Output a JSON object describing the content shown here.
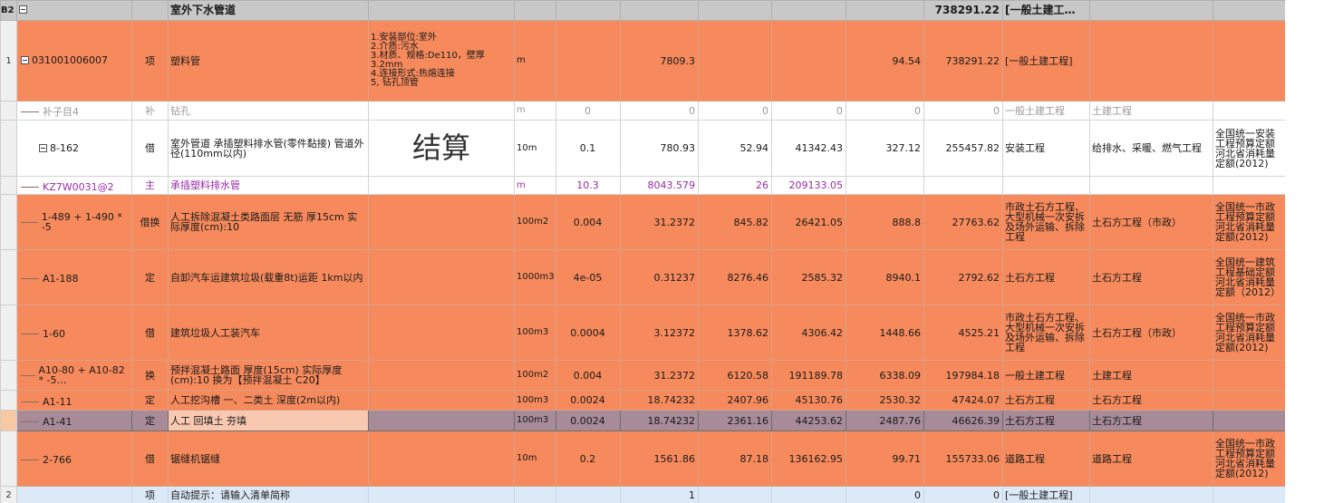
{
  "header": {
    "row_label": "B2",
    "title": "室外下水管道",
    "total": "738291.22",
    "category": "[一般土建工…"
  },
  "rows": [
    {
      "id": "r1",
      "style": "org",
      "no": "1",
      "toggle": true,
      "code": "031001006007",
      "type": "项",
      "name": "塑料管",
      "feature": "1.安装部位:室外\n2.介质:污水\n3.材质、规格:De110，壁厚3.2mm\n4.连接形式:热熔连接\n5, 钻孔顶管",
      "unit": "m",
      "qty": "",
      "amount": "7809.3",
      "price": "",
      "total_m": "",
      "unit_price": "94.54",
      "total": "738291.22",
      "spec": "[一般土建工程]",
      "sub": "",
      "quota": ""
    },
    {
      "id": "r2",
      "style": "white",
      "no": "",
      "toggle": false,
      "code": "补子目4",
      "type": "补",
      "name": "钻孔",
      "feature": "",
      "unit": "m",
      "qty": "0",
      "amount": "0",
      "price": "0",
      "total_m": "0",
      "unit_price": "0",
      "total": "0",
      "spec": "一般土建工程",
      "sub": "土建工程",
      "quota": "",
      "muted": true
    },
    {
      "id": "r3",
      "style": "white",
      "no": "",
      "toggle": true,
      "code": "8-162",
      "type": "借",
      "name": "室外管道 承插塑料排水管(零件黏接) 管道外径(110mm以内)",
      "feature": "结算",
      "unit": "10m",
      "qty": "0.1",
      "amount": "780.93",
      "price": "52.94",
      "total_m": "41342.43",
      "unit_price": "327.12",
      "total": "255457.82",
      "spec": "安装工程",
      "sub": "给排水、采暖、燃气工程",
      "quota": "全国统一安装工程预算定额河北省消耗量定额(2012)"
    },
    {
      "id": "r4",
      "style": "white",
      "no": "",
      "toggle": false,
      "code": "KZ7W0031@2",
      "type": "主",
      "name": "承插塑料排水管",
      "feature": "",
      "unit": "m",
      "qty": "10.3",
      "amount": "8043.579",
      "price": "26",
      "total_m": "209133.05",
      "unit_price": "",
      "total": "",
      "spec": "",
      "sub": "",
      "quota": "",
      "purple": true
    },
    {
      "id": "r5",
      "style": "org",
      "no": "",
      "toggle": false,
      "code": "1-489 + 1-490 * -5",
      "type": "借换",
      "name": "人工拆除混凝土类路面层 无筋 厚15cm 实际厚度(cm):10",
      "feature": "",
      "unit": "100m2",
      "qty": "0.004",
      "amount": "31.2372",
      "price": "845.82",
      "total_m": "26421.05",
      "unit_price": "888.8",
      "total": "27763.62",
      "spec": "市政土石方工程、大型机械一次安拆及场外运输、拆除工程",
      "sub": "土石方工程（市政）",
      "quota": "全国统一市政工程预算定额河北省消耗量定额(2012)"
    },
    {
      "id": "r6",
      "style": "org",
      "no": "",
      "toggle": false,
      "code": "A1-188",
      "type": "定",
      "name": "自卸汽车运建筑垃圾(载重8t)运距 1km以内",
      "feature": "",
      "unit": "1000m3",
      "qty": "4e-05",
      "amount": "0.31237",
      "price": "8276.46",
      "total_m": "2585.32",
      "unit_price": "8940.1",
      "total": "2792.62",
      "spec": "土石方工程",
      "sub": "土石方工程",
      "quota": "全国统一建筑工程基础定额河北省消耗量定额（2012）"
    },
    {
      "id": "r7",
      "style": "org",
      "no": "",
      "toggle": false,
      "code": "1-60",
      "type": "借",
      "name": "建筑垃圾人工装汽车",
      "feature": "",
      "unit": "100m3",
      "qty": "0.0004",
      "amount": "3.12372",
      "price": "1378.62",
      "total_m": "4306.42",
      "unit_price": "1448.66",
      "total": "4525.21",
      "spec": "市政土石方工程、大型机械一次安拆及场外运输、拆除工程",
      "sub": "土石方工程（市政）",
      "quota": "全国统一市政工程预算定额河北省消耗量定额(2012)"
    },
    {
      "id": "r8",
      "style": "org",
      "no": "",
      "toggle": false,
      "code": "A10-80 + A10-82 * -5…",
      "type": "换",
      "name": "预拌混凝土路面 厚度(15cm)  实际厚度(cm):10  换为【预拌混凝土 C20】",
      "feature": "",
      "unit": "100m2",
      "qty": "0.004",
      "amount": "31.2372",
      "price": "6120.58",
      "total_m": "191189.78",
      "unit_price": "6338.09",
      "total": "197984.18",
      "spec": "一般土建工程",
      "sub": "土建工程",
      "quota": ""
    },
    {
      "id": "r9",
      "style": "org",
      "no": "",
      "toggle": false,
      "code": "A1-11",
      "type": "定",
      "name": "人工挖沟槽 一、二类土 深度(2m以内)",
      "feature": "",
      "unit": "100m3",
      "qty": "0.0024",
      "amount": "18.74232",
      "price": "2407.96",
      "total_m": "45130.76",
      "unit_price": "2530.32",
      "total": "47424.07",
      "spec": "土石方工程",
      "sub": "土石方工程",
      "quota": ""
    },
    {
      "id": "r10",
      "style": "sel",
      "no": "",
      "toggle": false,
      "code": "A1-41",
      "type": "定",
      "name": "人工 回填土 夯填",
      "feature": "",
      "unit": "100m3",
      "qty": "0.0024",
      "amount": "18.74232",
      "price": "2361.16",
      "total_m": "44253.62",
      "unit_price": "2487.76",
      "total": "46626.39",
      "spec": "土石方工程",
      "sub": "土石方工程",
      "quota": ""
    },
    {
      "id": "r11",
      "style": "org",
      "no": "",
      "toggle": false,
      "code": "2-766",
      "type": "借",
      "name": "锯缝机锯缝",
      "feature": "",
      "unit": "10m",
      "qty": "0.2",
      "amount": "1561.86",
      "price": "87.18",
      "total_m": "136162.95",
      "unit_price": "99.71",
      "total": "155733.06",
      "spec": "道路工程",
      "sub": "道路工程",
      "quota": "全国统一市政工程预算定额河北省消耗量定额(2012)"
    },
    {
      "id": "r12",
      "style": "blue",
      "no": "2",
      "toggle": false,
      "code": "",
      "type": "项",
      "name": "自动提示：请输入清单简称",
      "feature": "",
      "unit": "",
      "qty": "",
      "amount": "1",
      "price": "",
      "total_m": "",
      "unit_price": "0",
      "total": "0",
      "spec": "[一般土建工程]",
      "sub": "",
      "quota": ""
    }
  ]
}
